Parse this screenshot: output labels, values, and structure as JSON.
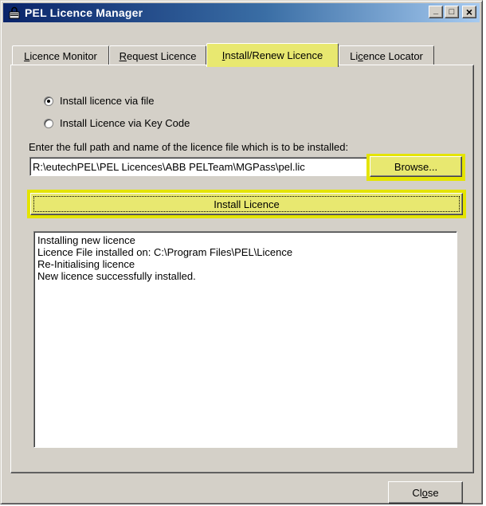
{
  "window": {
    "title": "PEL Licence Manager",
    "icon": "padlock-app-icon",
    "controls": {
      "minimize": "_",
      "maximize": "□",
      "close": "×"
    }
  },
  "tabs": [
    {
      "label": "Licence Monitor",
      "mnemonic_index": 0,
      "active": false
    },
    {
      "label": "Request Licence",
      "mnemonic_index": 0,
      "active": false
    },
    {
      "label": "Install/Renew Licence",
      "mnemonic_index": 0,
      "active": true
    },
    {
      "label": "Licence Locator",
      "mnemonic_index": 2,
      "active": false
    }
  ],
  "install": {
    "radio_file": {
      "label": "Install licence via file",
      "checked": true
    },
    "radio_key": {
      "label": "Install Licence via Key Code",
      "checked": false
    },
    "path_prompt": "Enter the full path and name of the licence file which is to be installed:",
    "path_value": "R:\\eutechPEL\\PEL Licences\\ABB PELTeam\\MGPass\\pel.lic",
    "browse_label": "Browse...",
    "install_label": "Install Licence"
  },
  "log": {
    "lines": [
      "Installing new licence",
      "Licence File installed on: C:\\Program Files\\PEL\\Licence",
      "Re-Initialising licence",
      "New licence successfully installed."
    ]
  },
  "footer": {
    "close_label": "Close",
    "close_mnemonic_index": 2
  },
  "colors": {
    "dialog_face": "#d4d0c8",
    "titlebar_start": "#0a246a",
    "titlebar_end": "#a6caf0",
    "highlight": "#e4e400",
    "highlight_fill": "#e8e870"
  }
}
